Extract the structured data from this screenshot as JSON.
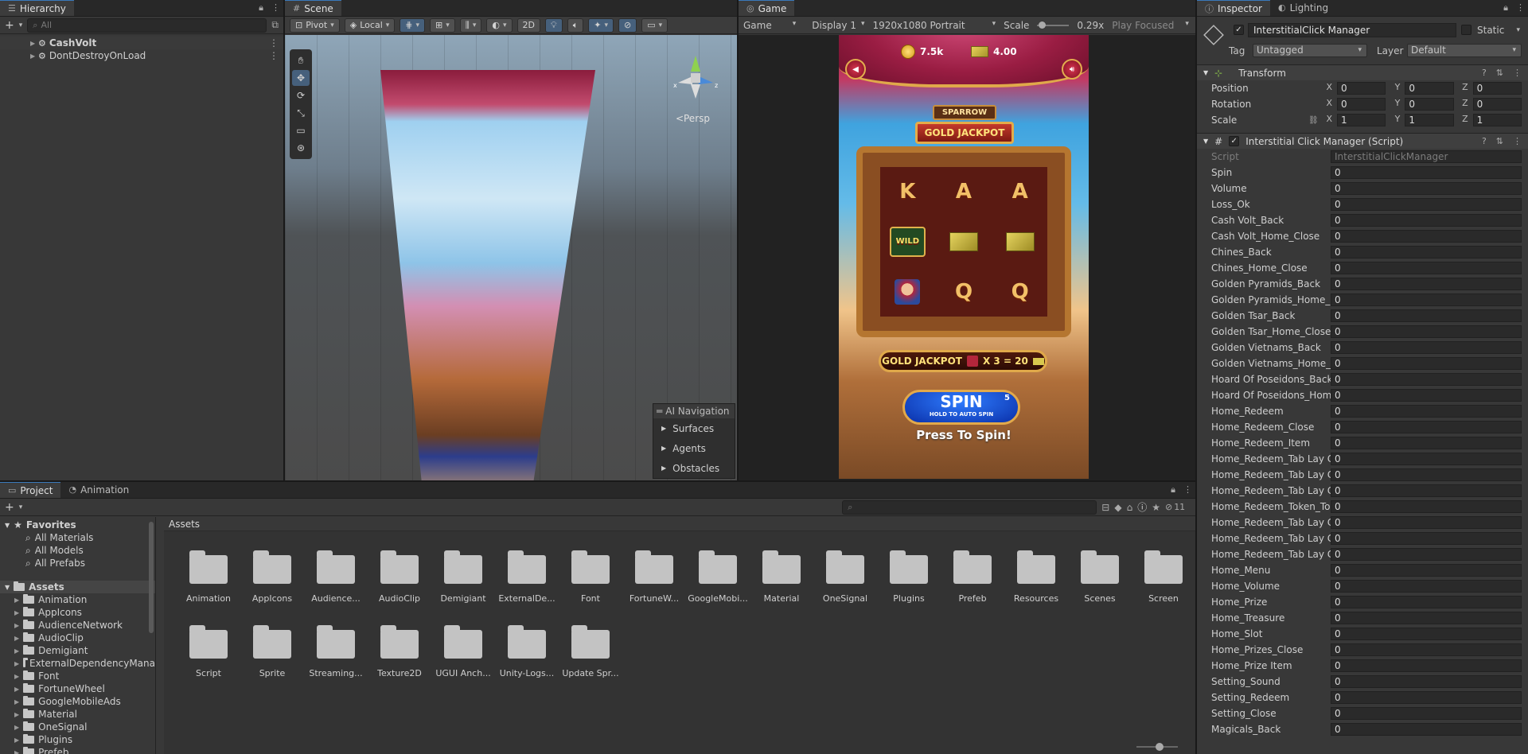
{
  "hierarchy": {
    "tab": "Hierarchy",
    "search_placeholder": "All",
    "items": [
      {
        "label": "CashVolt"
      },
      {
        "label": "DontDestroyOnLoad"
      }
    ]
  },
  "scene": {
    "tab": "Scene",
    "pivot": "Pivot",
    "local": "Local",
    "mode_2d": "2D",
    "persp": "Persp",
    "ai_nav": {
      "title": "AI Navigation",
      "items": [
        "Surfaces",
        "Agents",
        "Obstacles"
      ]
    }
  },
  "game": {
    "tab": "Game",
    "mode": "Game",
    "display": "Display 1",
    "resolution": "1920x1080 Portrait",
    "scale_label": "Scale",
    "scale_value": "0.29x",
    "play_focused": "Play Focused",
    "coins": "7.5k",
    "cash": "4.00",
    "sign_top": "SPARROW",
    "sign_main": "GOLD JACKPOT",
    "reels": [
      "K",
      "A",
      "A",
      "WILD",
      "money",
      "money",
      "pirate",
      "Q",
      "Q"
    ],
    "payline_label": "GOLD JACKPOT",
    "payline_value": "X 3 = 20",
    "spin_label": "SPIN",
    "spin_sub": "HOLD TO AUTO SPIN",
    "spin_count": "5",
    "press_to_spin": "Press To Spin!"
  },
  "inspector": {
    "tabs": [
      "Inspector",
      "Lighting"
    ],
    "object_name": "InterstitialClick Manager",
    "static_label": "Static",
    "tag_label": "Tag",
    "tag_value": "Untagged",
    "layer_label": "Layer",
    "layer_value": "Default",
    "transform": {
      "title": "Transform",
      "rows": [
        {
          "label": "Position",
          "x": "0",
          "y": "0",
          "z": "0"
        },
        {
          "label": "Rotation",
          "x": "0",
          "y": "0",
          "z": "0"
        },
        {
          "label": "Scale",
          "x": "1",
          "y": "1",
          "z": "1"
        }
      ]
    },
    "script_component": {
      "title": "Interstitial Click Manager (Script)",
      "script_label": "Script",
      "script_value": "InterstitialClickManager",
      "fields": [
        {
          "label": "Spin",
          "value": "0"
        },
        {
          "label": "Volume",
          "value": "0"
        },
        {
          "label": "Loss_Ok",
          "value": "0"
        },
        {
          "label": "Cash Volt_Back",
          "value": "0"
        },
        {
          "label": "Cash Volt_Home_Close",
          "value": "0"
        },
        {
          "label": "Chines_Back",
          "value": "0"
        },
        {
          "label": "Chines_Home_Close",
          "value": "0"
        },
        {
          "label": "Golden Pyramids_Back",
          "value": "0"
        },
        {
          "label": "Golden Pyramids_Home_C",
          "value": "0"
        },
        {
          "label": "Golden Tsar_Back",
          "value": "0"
        },
        {
          "label": "Golden Tsar_Home_Close",
          "value": "0"
        },
        {
          "label": "Golden Vietnams_Back",
          "value": "0"
        },
        {
          "label": "Golden Vietnams_Home_C",
          "value": "0"
        },
        {
          "label": "Hoard Of Poseidons_Back",
          "value": "0"
        },
        {
          "label": "Hoard Of Poseidons_Hom",
          "value": "0"
        },
        {
          "label": "Home_Redeem",
          "value": "0"
        },
        {
          "label": "Home_Redeem_Close",
          "value": "0"
        },
        {
          "label": "Home_Redeem_Item",
          "value": "0"
        },
        {
          "label": "Home_Redeem_Tab Lay C",
          "value": "0"
        },
        {
          "label": "Home_Redeem_Tab Lay C",
          "value": "0"
        },
        {
          "label": "Home_Redeem_Tab Lay C",
          "value": "0"
        },
        {
          "label": "Home_Redeem_Token_To",
          "value": "0"
        },
        {
          "label": "Home_Redeem_Tab Lay C",
          "value": "0"
        },
        {
          "label": "Home_Redeem_Tab Lay C",
          "value": "0"
        },
        {
          "label": "Home_Redeem_Tab Lay C",
          "value": "0"
        },
        {
          "label": "Home_Menu",
          "value": "0"
        },
        {
          "label": "Home_Volume",
          "value": "0"
        },
        {
          "label": "Home_Prize",
          "value": "0"
        },
        {
          "label": "Home_Treasure",
          "value": "0"
        },
        {
          "label": "Home_Slot",
          "value": "0"
        },
        {
          "label": "Home_Prizes_Close",
          "value": "0"
        },
        {
          "label": "Home_Prize Item",
          "value": "0"
        },
        {
          "label": "Setting_Sound",
          "value": "0"
        },
        {
          "label": "Setting_Redeem",
          "value": "0"
        },
        {
          "label": "Setting_Close",
          "value": "0"
        },
        {
          "label": "Magicals_Back",
          "value": "0"
        }
      ]
    }
  },
  "project": {
    "tabs": [
      "Project",
      "Animation"
    ],
    "hidden_count": "11",
    "favorites_label": "Favorites",
    "favorites": [
      "All Materials",
      "All Models",
      "All Prefabs"
    ],
    "assets_label": "Assets",
    "tree": [
      "Animation",
      "AppIcons",
      "AudienceNetwork",
      "AudioClip",
      "Demigiant",
      "ExternalDependencyMana",
      "Font",
      "FortuneWheel",
      "GoogleMobileAds",
      "Material",
      "OneSignal",
      "Plugins",
      "Prefeb"
    ],
    "breadcrumb": "Assets",
    "folders": [
      "Animation",
      "AppIcons",
      "Audience...",
      "AudioClip",
      "Demigiant",
      "ExternalDe...",
      "Font",
      "FortuneW...",
      "GoogleMobi...",
      "Material",
      "OneSignal",
      "Plugins",
      "Prefeb",
      "Resources",
      "Scenes",
      "Screen",
      "Script",
      "Sprite",
      "Streaming...",
      "Texture2D",
      "UGUI Anch...",
      "Unity-Logs...",
      "Update Spr..."
    ]
  }
}
